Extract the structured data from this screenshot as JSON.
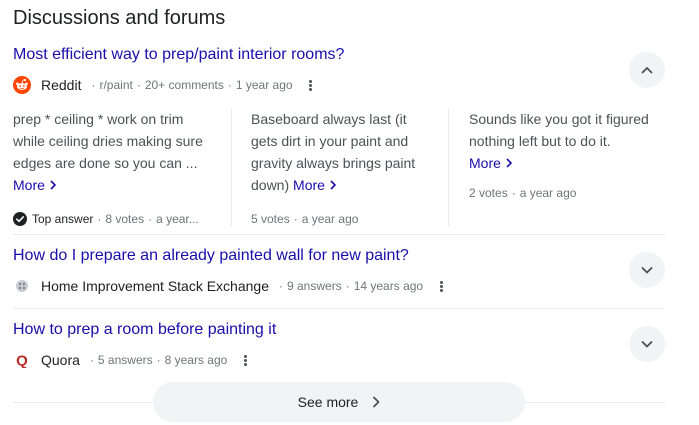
{
  "section_title": "Discussions and forums",
  "items": [
    {
      "title": "Most efficient way to prep/paint interior rooms?",
      "source": "Reddit",
      "sub": "r/paint",
      "count": "20+ comments",
      "age": "1 year ago",
      "expanded": true,
      "answers": [
        {
          "text": "prep * ceiling * work on trim while ceiling dries making sure edges are done so you can ...",
          "more": "More",
          "badge": "Top answer",
          "votes": "8 votes",
          "age": "a year..."
        },
        {
          "text": "Baseboard always last (it gets dirt in your paint and gravity always brings paint down)",
          "more": "More",
          "votes": "5 votes",
          "age": "a year ago"
        },
        {
          "text": "Sounds like you got it figured nothing left but to do it.",
          "more": "More",
          "votes": "2 votes",
          "age": "a year ago"
        }
      ]
    },
    {
      "title": "How do I prepare an already painted wall for new paint?",
      "source": "Home Improvement Stack Exchange",
      "count": "9 answers",
      "age": "14 years ago",
      "expanded": false
    },
    {
      "title": "How to prep a room before painting it",
      "source": "Quora",
      "count": "5 answers",
      "age": "8 years ago",
      "expanded": false
    }
  ],
  "see_more": "See more",
  "sep": "·",
  "icons": {
    "reddit": "reddit-icon",
    "stackexchange": "stackexchange-icon",
    "quora": "quora-icon",
    "check": "check-circle-icon",
    "chevron_up": "chevron-up-icon",
    "chevron_down": "chevron-down-icon",
    "chevron_right": "chevron-right-icon",
    "kebab": "more-vert-icon"
  },
  "colors": {
    "link": "#1a0dab",
    "reddit": "#ff4500",
    "quora": "#b92b27"
  }
}
